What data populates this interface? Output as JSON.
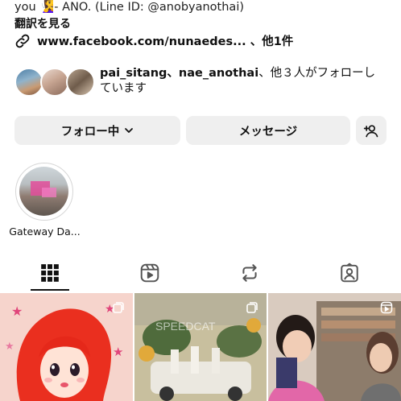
{
  "bio": {
    "line1": "you 🧏‍♀️- ANO. (Line ID: @anobyanothai)",
    "translate": "翻訳を見る",
    "link": "www.facebook.com/nunaedes... 、他1件"
  },
  "followers": {
    "names": "pai_sitang、nae_anothai",
    "suffix": "、他３人がフォローしています"
  },
  "buttons": {
    "following": "フォロー中",
    "message": "メッセージ"
  },
  "highlights": [
    {
      "label": "Gateway Da..."
    }
  ],
  "grid": {
    "cell2_overlay": "SPEEDCAT"
  },
  "icons": {
    "link": "link-icon",
    "chevron": "chevron-down-icon",
    "add_user": "add-user-icon",
    "tabs": [
      "grid-icon",
      "reels-icon",
      "reposts-icon",
      "tagged-icon"
    ]
  }
}
